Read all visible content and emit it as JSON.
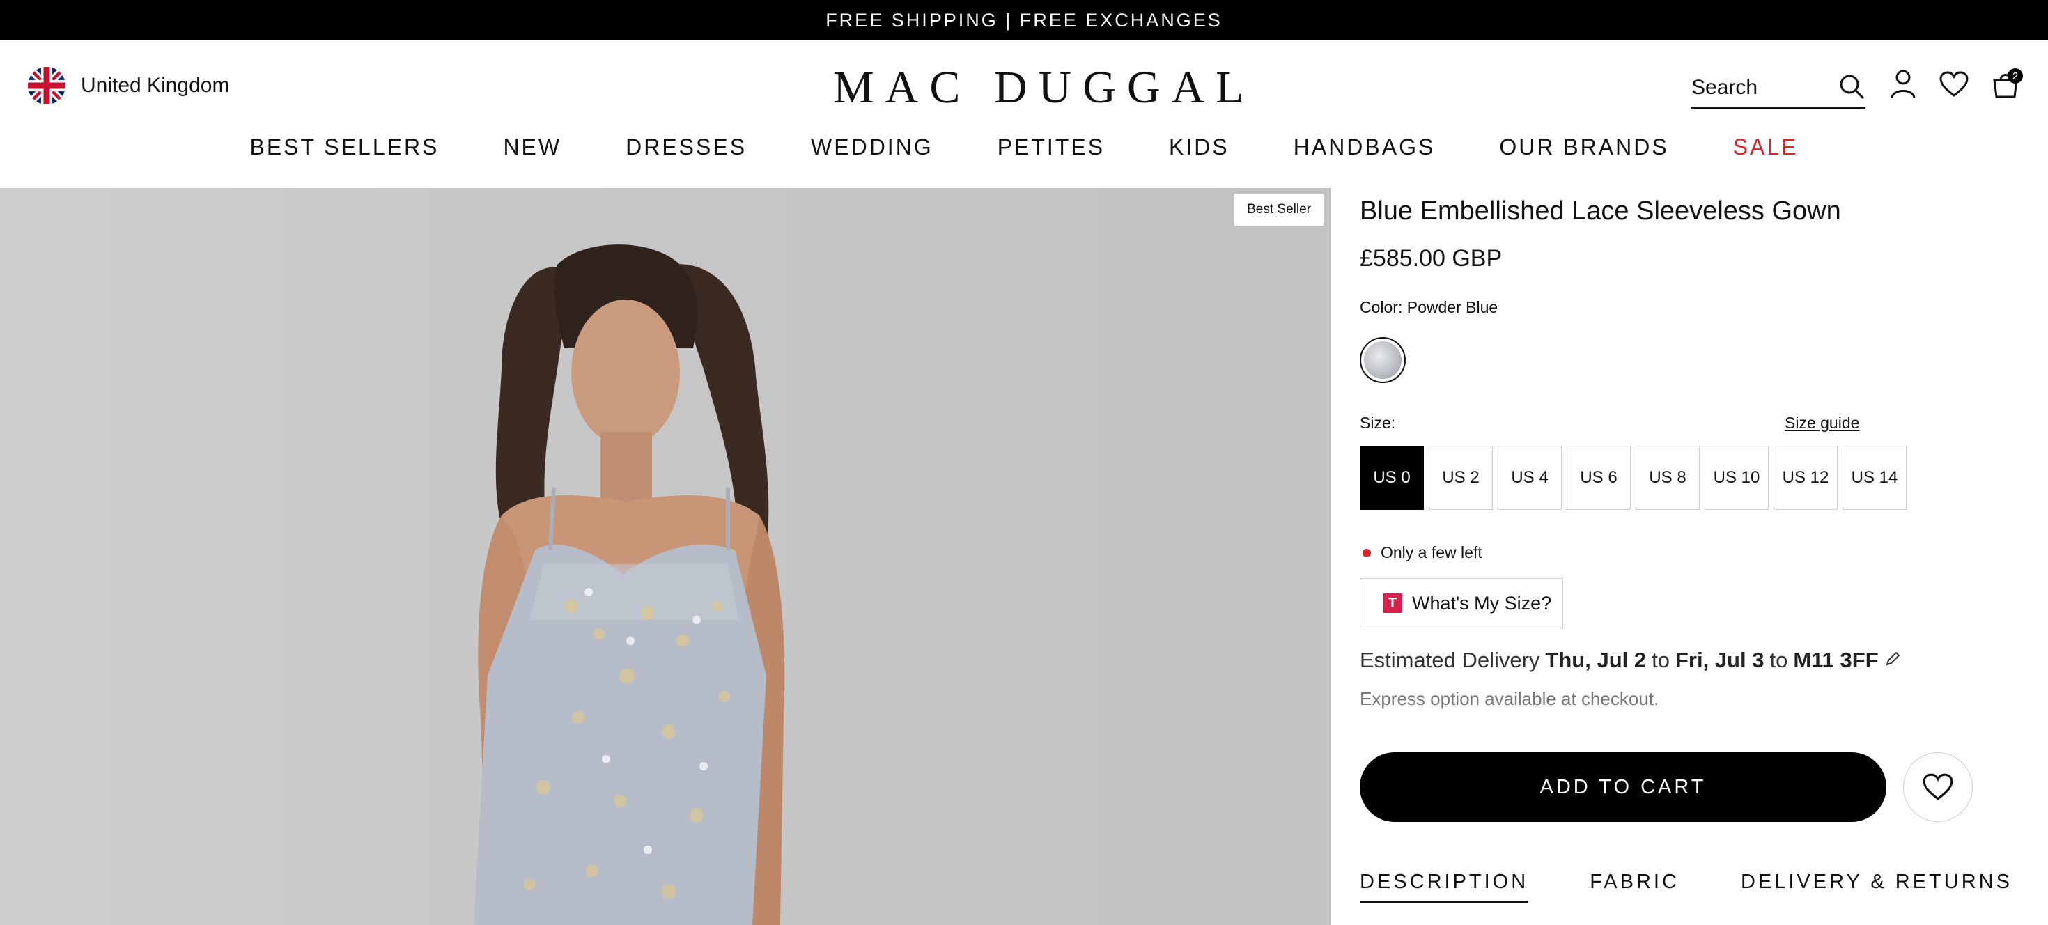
{
  "announcement": "FREE SHIPPING | FREE EXCHANGES",
  "header": {
    "region": "United Kingdom",
    "logo": "MAC DUGGAL",
    "search_placeholder": "Search",
    "cart_count": "2"
  },
  "nav": {
    "items": [
      "BEST SELLERS",
      "NEW",
      "DRESSES",
      "WEDDING",
      "PETITES",
      "KIDS",
      "HANDBAGS",
      "OUR BRANDS",
      "SALE"
    ]
  },
  "gallery": {
    "badge": "Best Seller"
  },
  "product": {
    "title": "Blue Embellished Lace Sleeveless Gown",
    "price": "£585.00 GBP",
    "color_label": "Color:",
    "color_value": "Powder Blue",
    "size_label": "Size:",
    "size_guide": "Size guide",
    "sizes": [
      "US 0",
      "US 2",
      "US 4",
      "US 6",
      "US 8",
      "US 10",
      "US 12",
      "US 14"
    ],
    "selected_size": "US 0",
    "stock": "Only a few left",
    "whats_my_size": "What's My Size?",
    "delivery": {
      "prefix": "Estimated Delivery",
      "from": "Thu, Jul 2",
      "to_word": "to",
      "until": "Fri, Jul 3",
      "to_word2": "to",
      "postcode": "M11 3FF"
    },
    "express": "Express option available at checkout.",
    "add_to_cart": "ADD TO CART"
  },
  "tabs": [
    "DESCRIPTION",
    "FABRIC",
    "DELIVERY & RETURNS"
  ],
  "colors": {
    "sale": "#d8262b",
    "stock_dot": "#d8262b",
    "button": "#000000"
  }
}
